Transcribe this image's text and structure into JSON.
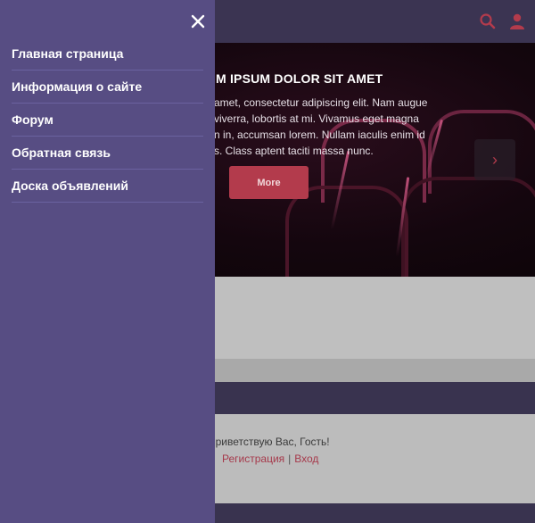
{
  "header": {
    "search_icon": "search-icon",
    "user_icon": "user-icon",
    "accent_color": "#b33b4c"
  },
  "hero": {
    "title": "M IPSUM DOLOR SIT AMET",
    "text_lines": [
      "amet, consectetur adipiscing elit. Nam augue",
      "viverra, lobortis at mi. Vivamus eget magna",
      "n in, accumsan lorem. Nullam iaculis enim id",
      "s. Class aptent taciti massa nunc."
    ],
    "button_label": "More",
    "next_arrow": "›"
  },
  "footer": {
    "greeting": "Приветствую Вас, Гость!",
    "register_link": "Регистрация",
    "separator": "|",
    "login_link": "Вход"
  },
  "drawer": {
    "close_icon": "close-icon",
    "background_color": "#574d83",
    "items": [
      {
        "label": "Главная страница"
      },
      {
        "label": "Информация о сайте"
      },
      {
        "label": "Форум"
      },
      {
        "label": "Обратная связь"
      },
      {
        "label": "Доска объявлений"
      }
    ]
  }
}
